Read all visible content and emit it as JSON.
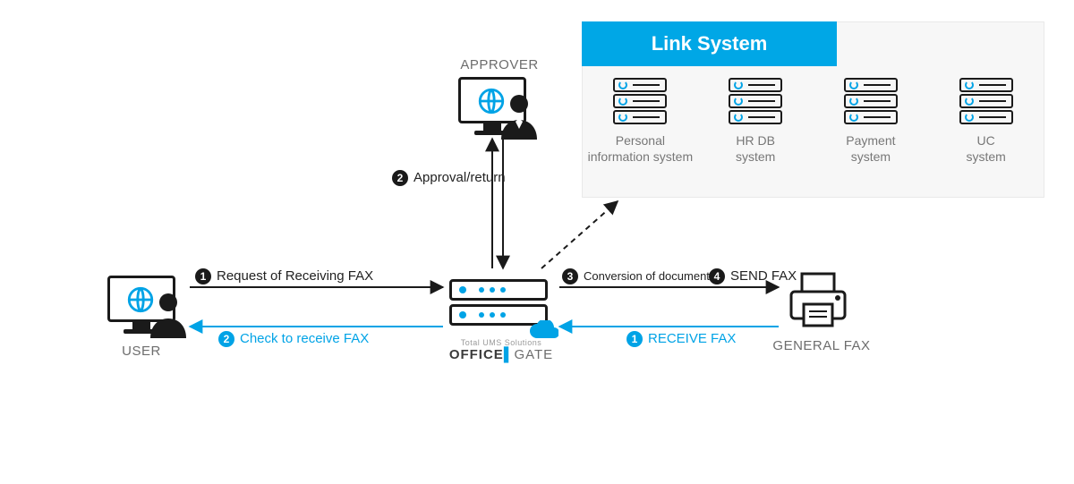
{
  "nodes": {
    "user_caption": "USER",
    "approver_caption": "APPROVER",
    "fax_caption": "GENERAL FAX",
    "gateway_tagline": "Total UMS Solutions",
    "gateway_name_a": "OFFICE",
    "gateway_name_b": "GATE"
  },
  "flows": {
    "request": "Request of Receiving FAX",
    "check": "Check to receive FAX",
    "approval": "Approval/return",
    "convert": "Conversion of document",
    "send": "SEND FAX",
    "receive": "RECEIVE FAX"
  },
  "link_system": {
    "title": "Link System",
    "items": [
      "Personal\ninformation system",
      "HR DB\nsystem",
      "Payment\nsystem",
      "UC\nsystem"
    ]
  },
  "colors": {
    "accent": "#00a3e6",
    "ink": "#1a1a1a",
    "panel": "#f7f7f7"
  }
}
